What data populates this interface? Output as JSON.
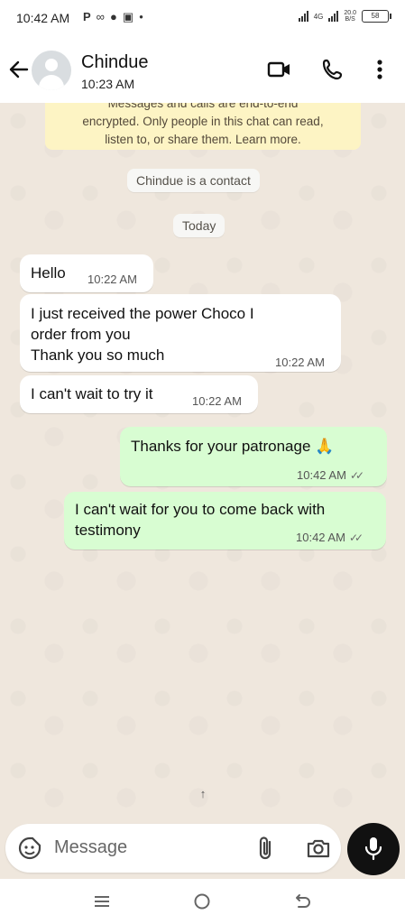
{
  "status_bar": {
    "time": "10:42 AM",
    "network": "4G",
    "net_speed_value": "20.0",
    "net_speed_unit": "B/S",
    "battery": "58"
  },
  "header": {
    "contact_name": "Chindue",
    "subtitle": "10:23 AM"
  },
  "encryption_notice": {
    "line1": "Messages and calls are end-to-end",
    "line2": "encrypted. Only people in this chat can read,",
    "line3": "listen to, or share them. Learn more."
  },
  "system_messages": {
    "contact_note": "Chindue is a contact",
    "date_divider": "Today"
  },
  "messages": [
    {
      "direction": "incoming",
      "lines": [
        "Hello"
      ],
      "time": "10:22 AM"
    },
    {
      "direction": "incoming",
      "lines": [
        "I just received the power Choco I",
        "order from you",
        "Thank you so much"
      ],
      "time": "10:22 AM"
    },
    {
      "direction": "incoming",
      "lines": [
        "I can't wait to try it"
      ],
      "time": "10:22 AM"
    },
    {
      "direction": "outgoing",
      "lines": [
        "Thanks for your patronage 🙏"
      ],
      "time": "10:42 AM",
      "status": "read"
    },
    {
      "direction": "outgoing",
      "lines": [
        "I can't wait for you to come back with",
        "testimony"
      ],
      "time": "10:42 AM",
      "status": "read"
    }
  ],
  "composer": {
    "placeholder": "Message"
  },
  "icons": {
    "back": "back-arrow-icon",
    "video": "video-call-icon",
    "voice": "voice-call-icon",
    "menu": "more-options-icon",
    "sticker": "sticker-icon",
    "attach": "paperclip-icon",
    "camera": "camera-icon",
    "mic": "microphone-icon"
  },
  "colors": {
    "outgoing_bubble": "#d8fdd2",
    "incoming_bubble": "#ffffff",
    "chat_background": "#efe7dd",
    "encryption_notice_bg": "#fdf4c4",
    "read_ticks": "#6b6b6b"
  }
}
